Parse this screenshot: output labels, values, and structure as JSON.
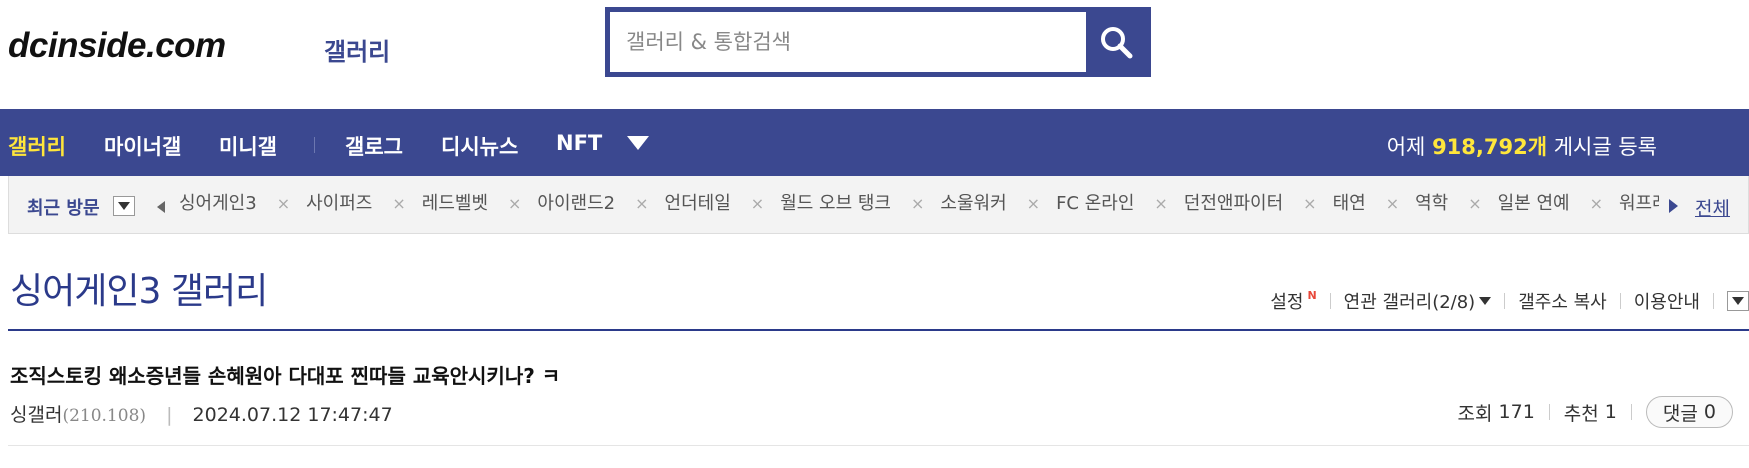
{
  "header": {
    "logo": "dcinside.com",
    "logo_sub": "갤러리",
    "search_placeholder": "갤러리 & 통합검색"
  },
  "nav": {
    "items": [
      "갤러리",
      "마이너갤",
      "미니갤",
      "갤로그",
      "디시뉴스",
      "NFT"
    ],
    "stat_prefix": "어제",
    "stat_count": "918,792개",
    "stat_suffix": "게시글 등록"
  },
  "recent": {
    "title": "최근 방문",
    "items": [
      "싱어게인3",
      "사이퍼즈",
      "레드벨벳",
      "아이랜드2",
      "언더테일",
      "월드 오브 탱크",
      "소울워커",
      "FC 온라인",
      "던전앤파이터",
      "태연",
      "역학",
      "일본 연예",
      "워프레임"
    ],
    "close_symbol": "×",
    "all_label": "전체"
  },
  "gallery": {
    "title": "싱어게인3 갤러리",
    "menu": {
      "settings": "설정",
      "settings_badge": "N",
      "related": "연관 갤러리(2/8)",
      "copy_address": "갤주소 복사",
      "guide": "이용안내"
    }
  },
  "post": {
    "title": "조직스토킹 왜소증년들 손혜원아 다대포 찐따들 교육안시키나? ㅋ",
    "author": "싱갤러",
    "ip": "(210.108)",
    "datetime": "2024.07.12 17:47:47",
    "views_label": "조회",
    "views": "171",
    "recommend_label": "추천",
    "recommend": "1",
    "comment_label": "댓글",
    "comments": "0"
  },
  "colors": {
    "brand": "#3b4890",
    "highlight": "#ffe63b",
    "title_blue": "#2b3a8a"
  }
}
